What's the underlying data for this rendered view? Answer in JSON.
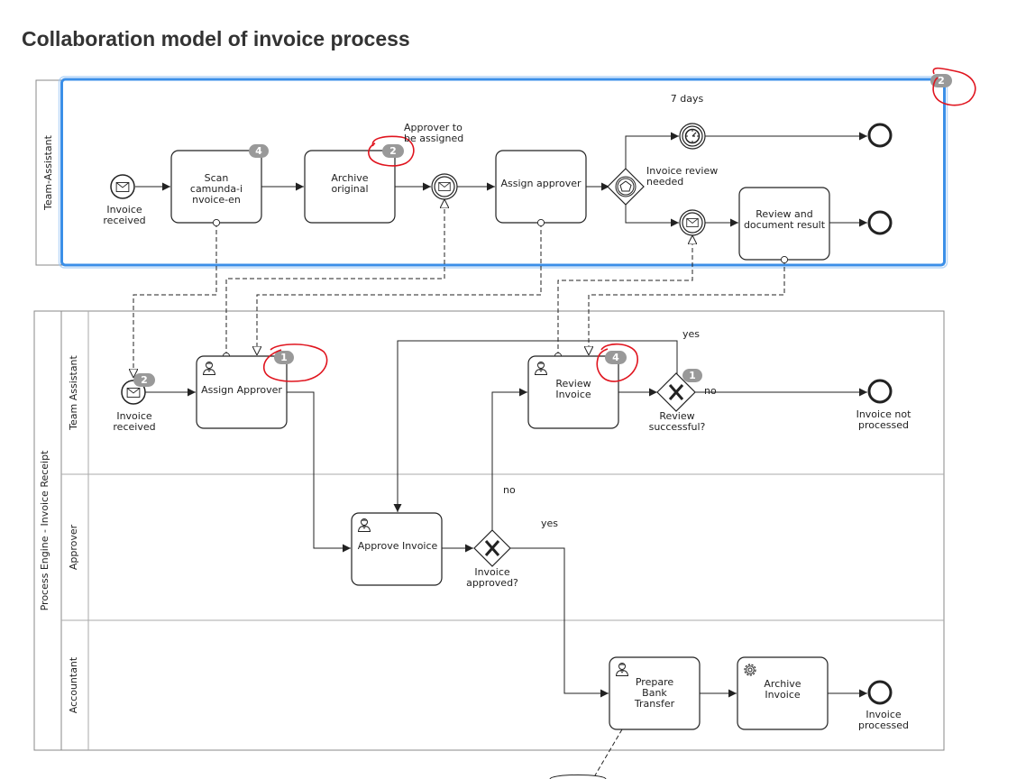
{
  "title": "Collaboration model of invoice process",
  "colors": {
    "selection": "#3b8fe8",
    "annotation": "#e0141e",
    "badge": "#999999",
    "stroke": "#222222"
  },
  "icons": [
    "envelope-icon",
    "timer-icon",
    "pentagon-icon",
    "user-icon",
    "gear-icon",
    "gateway-x-icon"
  ],
  "pool_team_assistant": {
    "label": "Team-Assistant",
    "start_event": [
      "Invoice",
      "received"
    ],
    "task_scan": [
      "Scan",
      "camunda-i",
      "nvoice-en"
    ],
    "task_scan_badge": "4",
    "task_archive": [
      "Archive",
      "original"
    ],
    "task_archive_badge": "2",
    "annotation_approver": [
      "Approver to",
      "be assigned"
    ],
    "task_assign": "Assign approver",
    "gateway_label": [
      "Invoice review",
      "needed"
    ],
    "timer_label": "7 days",
    "task_review_doc": [
      "Review and",
      "document result"
    ],
    "pool_badge": "2"
  },
  "pool_process_engine": {
    "label": "Process Engine - Invoice Receipt",
    "lanes": [
      "Team Assistant",
      "Approver",
      "Accountant"
    ],
    "start_event": [
      "Invoice",
      "received"
    ],
    "start_badge": "2",
    "task_assign_approver": "Assign Approver",
    "task_assign_badge": "1",
    "task_review_invoice": [
      "Review",
      "Invoice"
    ],
    "task_review_badge": "4",
    "gateway_review": [
      "Review",
      "successful?"
    ],
    "gateway_review_badge": "1",
    "flow_yes_top": "yes",
    "flow_no_right": "no",
    "end_not_processed": [
      "Invoice not",
      "processed"
    ],
    "task_approve_invoice": "Approve Invoice",
    "gateway_approved": [
      "Invoice",
      "approved?"
    ],
    "flow_no_up": "no",
    "flow_yes_right": "yes",
    "task_prepare": [
      "Prepare",
      "Bank",
      "Transfer"
    ],
    "task_archive_invoice": [
      "Archive",
      "Invoice"
    ],
    "end_processed": [
      "Invoice",
      "processed"
    ]
  }
}
